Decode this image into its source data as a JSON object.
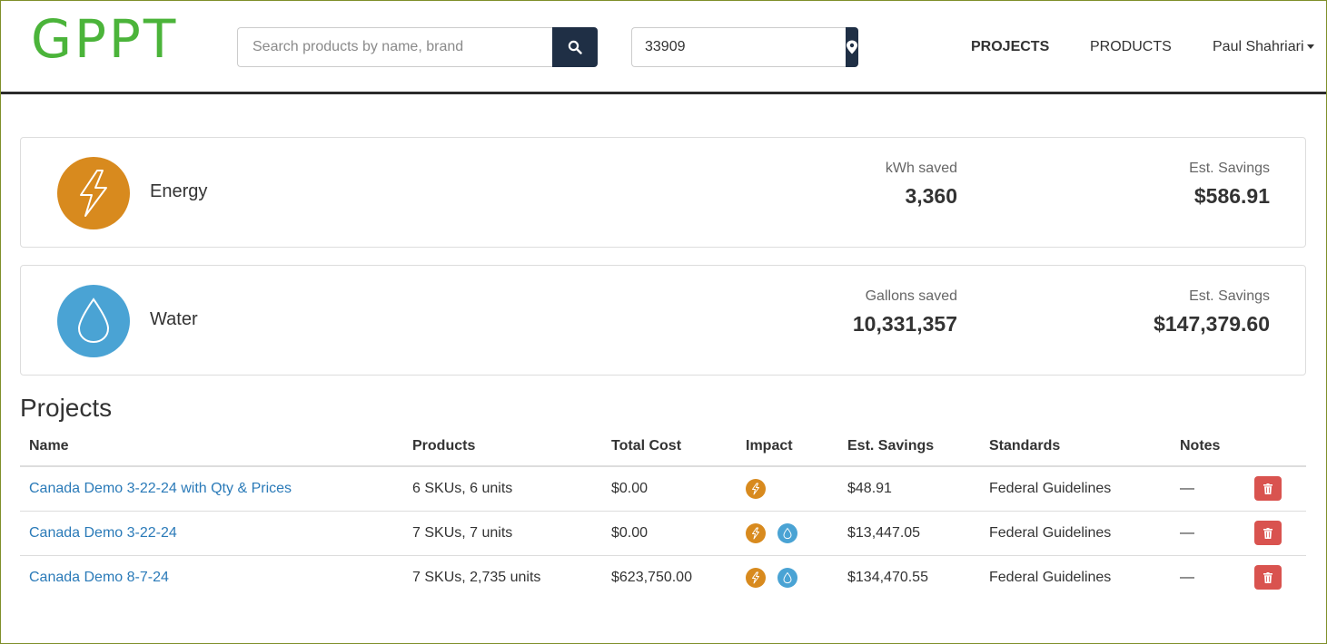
{
  "header": {
    "logo": "GPPT",
    "search": {
      "placeholder": "Search products by name, brand",
      "value": ""
    },
    "zip": {
      "value": "33909"
    },
    "nav": {
      "projects": "PROJECTS",
      "products": "PRODUCTS",
      "user": "Paul Shahriari"
    }
  },
  "summary": {
    "energy": {
      "title": "Energy",
      "stat1_label": "kWh saved",
      "stat1_value": "3,360",
      "stat2_label": "Est. Savings",
      "stat2_value": "$586.91",
      "color": "#d88a1e"
    },
    "water": {
      "title": "Water",
      "stat1_label": "Gallons saved",
      "stat1_value": "10,331,357",
      "stat2_label": "Est. Savings",
      "stat2_value": "$147,379.60",
      "color": "#4aa3d4"
    }
  },
  "projects": {
    "title": "Projects",
    "columns": [
      "Name",
      "Products",
      "Total Cost",
      "Impact",
      "Est. Savings",
      "Standards",
      "Notes",
      ""
    ],
    "rows": [
      {
        "name": "Canada Demo 3-22-24 with Qty & Prices",
        "products": "6 SKUs, 6 units",
        "total_cost": "$0.00",
        "impact": [
          "energy"
        ],
        "savings": "$48.91",
        "standards": "Federal Guidelines",
        "notes": "—"
      },
      {
        "name": "Canada Demo 3-22-24",
        "products": "7 SKUs, 7 units",
        "total_cost": "$0.00",
        "impact": [
          "energy",
          "water"
        ],
        "savings": "$13,447.05",
        "standards": "Federal Guidelines",
        "notes": "—"
      },
      {
        "name": "Canada Demo 8-7-24",
        "products": "7 SKUs, 2,735 units",
        "total_cost": "$623,750.00",
        "impact": [
          "energy",
          "water"
        ],
        "savings": "$134,470.55",
        "standards": "Federal Guidelines",
        "notes": "—"
      }
    ]
  },
  "colors": {
    "logo": "#4bb43a",
    "nav_button": "#1f2f45",
    "link": "#2a7ab8",
    "danger": "#d9534f"
  }
}
